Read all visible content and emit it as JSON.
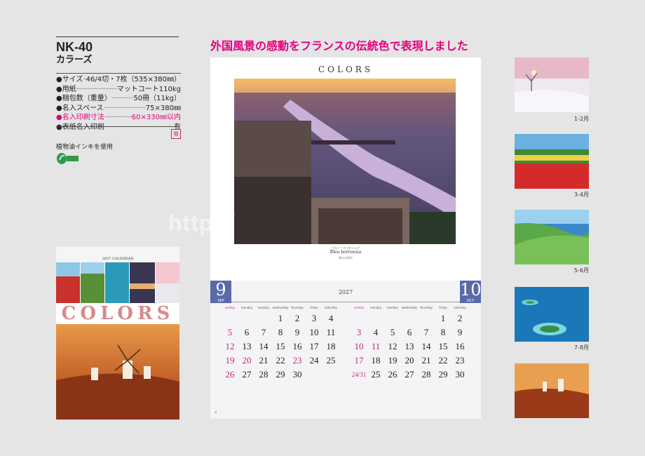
{
  "product": {
    "code": "NK-40",
    "name": "カラーズ",
    "specs": [
      {
        "label": "●サイズ",
        "value": "46/4切・7枚（535×380㎜）"
      },
      {
        "label": "●用紙",
        "value": "マットコート110kg"
      },
      {
        "label": "●梱包数（重量）",
        "value": "50冊（11kg）"
      },
      {
        "label": "●名入スペース",
        "value": "75×380㎜"
      },
      {
        "label": "●名入印刷寸法",
        "value": "60×330㎜以内",
        "highlight": true
      },
      {
        "label": "●表紙名入印刷",
        "value": "有"
      }
    ],
    "ink_note": "植物油インキを使用",
    "veg_logo_text": "VEGETABLE OIL INK",
    "mark_text": "梱"
  },
  "headline": "外国風景の感動をフランスの伝統色で表現しました",
  "cover": {
    "year_label": "2027 CALENDAR",
    "title": "COLORS"
  },
  "main": {
    "logo": "COLORS",
    "caption_jp": "ブルー・オルタンシア",
    "caption_fr": "Bleu hortensia",
    "caption_note": "紫みの青色",
    "left_month": {
      "number": "9",
      "abbr": "SEP"
    },
    "right_month": {
      "number": "10",
      "abbr": "OCT"
    },
    "year": "2027",
    "weekdays": [
      "sunday",
      "monday",
      "tuesday",
      "wednesday",
      "thursday",
      "friday",
      "saturday"
    ],
    "september": [
      [
        "",
        "",
        "",
        "1",
        "2",
        "3",
        "4"
      ],
      [
        "5",
        "6",
        "7",
        "8",
        "9",
        "10",
        "11"
      ],
      [
        "12",
        "13",
        "14",
        "15",
        "16",
        "17",
        "18"
      ],
      [
        "19",
        "20",
        "21",
        "22",
        "23",
        "24",
        "25"
      ],
      [
        "26",
        "27",
        "28",
        "29",
        "30",
        "",
        ""
      ]
    ],
    "september_holidays": [
      "20",
      "23"
    ],
    "october": [
      [
        "",
        "",
        "",
        "",
        "",
        "1",
        "2"
      ],
      [
        "3",
        "4",
        "5",
        "6",
        "7",
        "8",
        "9"
      ],
      [
        "10",
        "11",
        "12",
        "13",
        "14",
        "15",
        "16"
      ],
      [
        "17",
        "18",
        "19",
        "20",
        "21",
        "22",
        "23"
      ],
      [
        "24/31",
        "25",
        "26",
        "27",
        "28",
        "29",
        "30"
      ]
    ],
    "october_holidays": [
      "11"
    ]
  },
  "watermark": "http://",
  "thumbnails": [
    {
      "label": "1-2月",
      "scene": "snow"
    },
    {
      "label": "3-4月",
      "scene": "tulips"
    },
    {
      "label": "5-6月",
      "scene": "hills"
    },
    {
      "label": "7-8月",
      "scene": "lagoon"
    },
    {
      "label": "",
      "scene": "windmills"
    }
  ],
  "colors": {
    "accent": "#e4007f",
    "month_tab": "#5a6aa8",
    "holiday": "#c8286c"
  }
}
